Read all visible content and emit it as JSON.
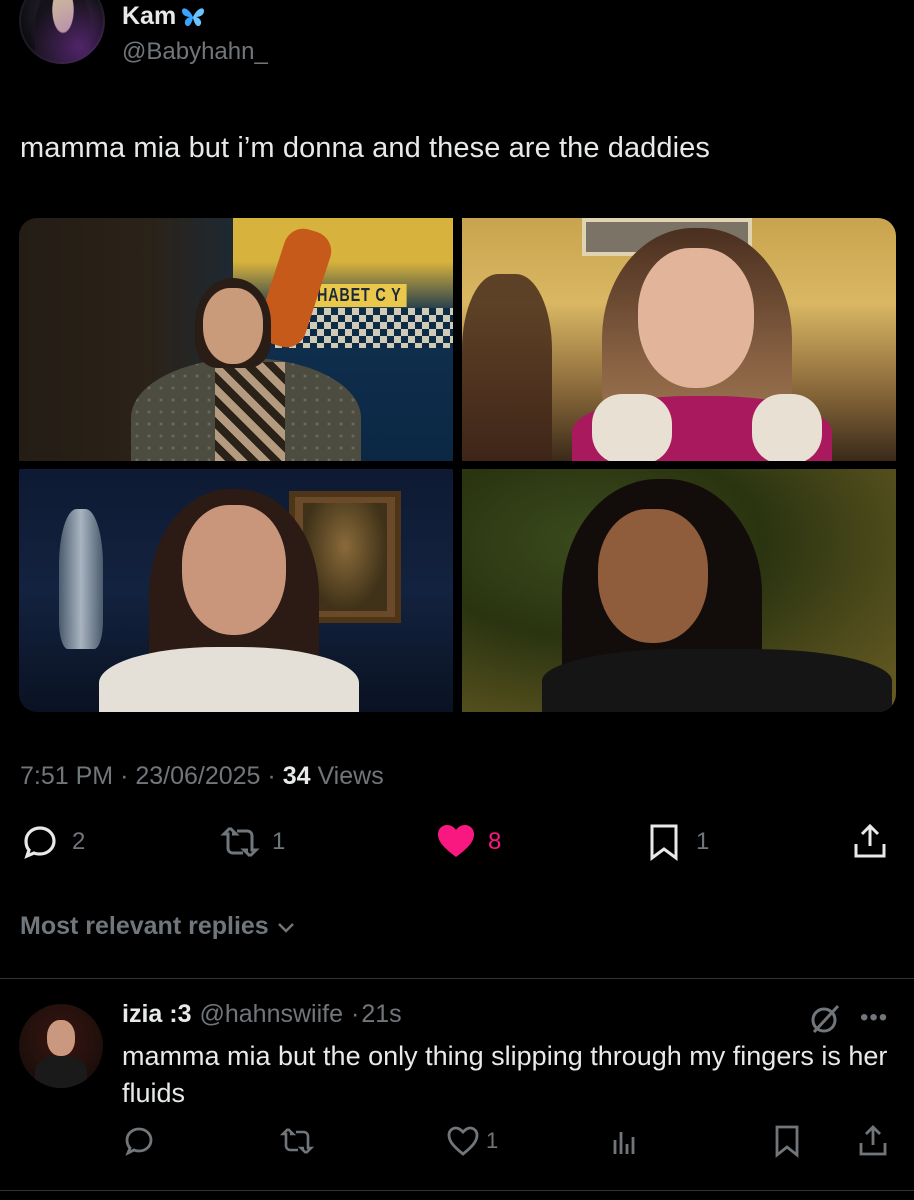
{
  "author": {
    "name": "Kam",
    "handle": "@Babyhahn_",
    "badge_icon": "butterfly-icon"
  },
  "tweet": {
    "text": "mamma mia but i’m donna and these are the daddies",
    "time": "7:51 PM",
    "date": "23/06/2025",
    "views_count": "34",
    "views_label": " Views"
  },
  "media": {
    "poster_text": "ALPHABET C   Y"
  },
  "actions": {
    "replies": "2",
    "reposts": "1",
    "likes": "8",
    "bookmarks": "1",
    "like_color": "#f91880"
  },
  "replies_section": {
    "label": "Most relevant replies"
  },
  "reply": {
    "name": "izia :3",
    "handle": "@hahnswiife",
    "separator": "·",
    "age": "21s",
    "text": "mamma mia but the only thing slipping through my fingers is her fluids",
    "likes": "1"
  },
  "colors": {
    "background": "#000000",
    "text": "#e7e9ea",
    "muted": "#71767b",
    "divider": "#2f3336"
  }
}
